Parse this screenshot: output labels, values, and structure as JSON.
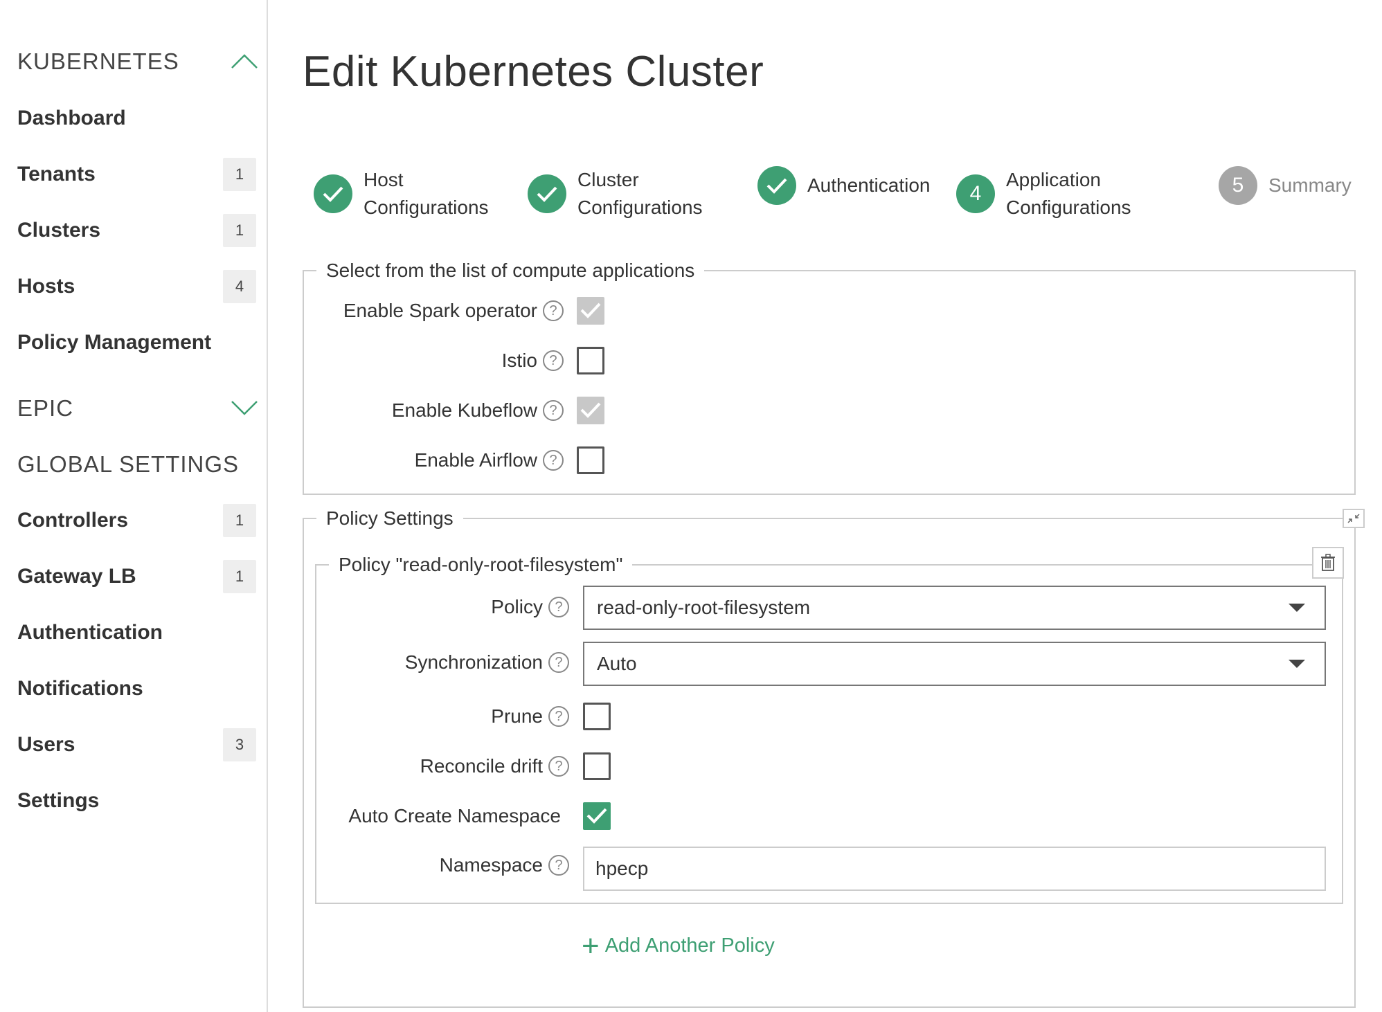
{
  "sidebar": {
    "kubernetes_title": "KUBERNETES",
    "kubernetes_items": [
      {
        "label": "Dashboard",
        "badge": ""
      },
      {
        "label": "Tenants",
        "badge": "1"
      },
      {
        "label": "Clusters",
        "badge": "1"
      },
      {
        "label": "Hosts",
        "badge": "4"
      },
      {
        "label": "Policy Management",
        "badge": ""
      }
    ],
    "epic_title": "EPIC",
    "global_title": "GLOBAL SETTINGS",
    "global_items": [
      {
        "label": "Controllers",
        "badge": "1"
      },
      {
        "label": "Gateway LB",
        "badge": "1"
      },
      {
        "label": "Authentication",
        "badge": ""
      },
      {
        "label": "Notifications",
        "badge": ""
      },
      {
        "label": "Users",
        "badge": "3"
      },
      {
        "label": "Settings",
        "badge": ""
      }
    ]
  },
  "page": {
    "title": "Edit Kubernetes Cluster"
  },
  "wizard": {
    "steps": [
      {
        "line1": "Host",
        "line2": "Configurations",
        "state": "done"
      },
      {
        "line1": "Cluster",
        "line2": "Configurations",
        "state": "done"
      },
      {
        "line1": "Authentication",
        "line2": "",
        "state": "done"
      },
      {
        "number": "4",
        "line1": "Application",
        "line2": "Configurations",
        "state": "current"
      },
      {
        "number": "5",
        "line1": "Summary",
        "line2": "",
        "state": "todo"
      }
    ]
  },
  "apps": {
    "legend": "Select from the list of compute applications",
    "items": [
      {
        "label": "Enable Spark operator",
        "checked": true,
        "disabled": true
      },
      {
        "label": "Istio",
        "checked": false,
        "disabled": false
      },
      {
        "label": "Enable Kubeflow",
        "checked": true,
        "disabled": true
      },
      {
        "label": "Enable Airflow",
        "checked": false,
        "disabled": false
      }
    ]
  },
  "policy_settings": {
    "legend": "Policy Settings",
    "policy": {
      "legend": "Policy \"read-only-root-filesystem\"",
      "policy_label": "Policy",
      "policy_value": "read-only-root-filesystem",
      "sync_label": "Synchronization",
      "sync_value": "Auto",
      "prune_label": "Prune",
      "prune_checked": false,
      "reconcile_label": "Reconcile drift",
      "reconcile_checked": false,
      "auto_ns_label": "Auto Create Namespace",
      "auto_ns_checked": true,
      "namespace_label": "Namespace",
      "namespace_value": "hpecp"
    },
    "add_label": "Add Another Policy"
  },
  "icons": {
    "help": "question-circle-icon",
    "delete": "trash-icon",
    "collapse": "collapse-icon",
    "chevron_up": "chevron-up-icon",
    "chevron_down": "chevron-down-icon",
    "check": "checkmark-icon",
    "plus": "plus-icon"
  },
  "colors": {
    "accent": "#3e9f73",
    "step_todo": "#a6a6a6",
    "disabled_check": "#c8c8c8"
  }
}
